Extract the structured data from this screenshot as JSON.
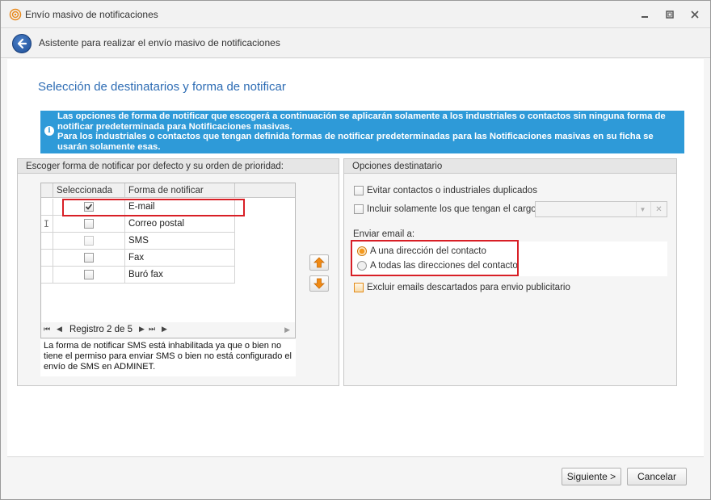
{
  "window": {
    "title": "Envío masivo de notificaciones"
  },
  "header": {
    "text": "Asistente para realizar el envío masivo de notificaciones"
  },
  "section_title": "Selección de destinatarios y forma de notificar",
  "info": {
    "line1": "Las opciones de forma de notificar que escogerá a continuación se aplicarán solamente a los industriales o contactos sin ninguna forma de notificar predeterminada para Notificaciones masivas.",
    "line2": "Para los  industriales o contactos que tengan definida formas de notificar predeterminadas para las Notificaciones masivas en su ficha se usarán solamente esas."
  },
  "left_panel": {
    "title": "Escoger forma de notificar por defecto y su orden de prioridad:",
    "columns": [
      "Seleccionada",
      "Forma de notificar"
    ],
    "rows": [
      {
        "name": "E-mail",
        "checked": true
      },
      {
        "name": "Correo postal",
        "checked": false
      },
      {
        "name": "SMS",
        "checked": false
      },
      {
        "name": "Fax",
        "checked": false
      },
      {
        "name": "Buró fax",
        "checked": false
      }
    ],
    "navigator": "Registro 2 de 5",
    "note": "La forma de notificar SMS está inhabilitada ya que o bien no tiene el permiso para enviar SMS o bien no está configurado el envío de SMS en ADMINET."
  },
  "right_panel": {
    "title": "Opciones destinatario",
    "avoid_duplicates": "Evitar contactos o industriales duplicados",
    "only_position": "Incluir solamente los que tengan el cargo:",
    "send_email_label": "Enviar email a:",
    "radio_one": "A una dirección del contacto",
    "radio_all": "A todas las direcciones del contacto",
    "exclude_emails": "Excluir emails descartados para envio publicitario"
  },
  "buttons": {
    "next": "Siguiente >",
    "cancel": "Cancelar"
  },
  "colors": {
    "accent": "#2d6cb4",
    "info_bar": "#2e9ad8",
    "highlight": "#d81f26",
    "orange": "#f59a1e"
  }
}
